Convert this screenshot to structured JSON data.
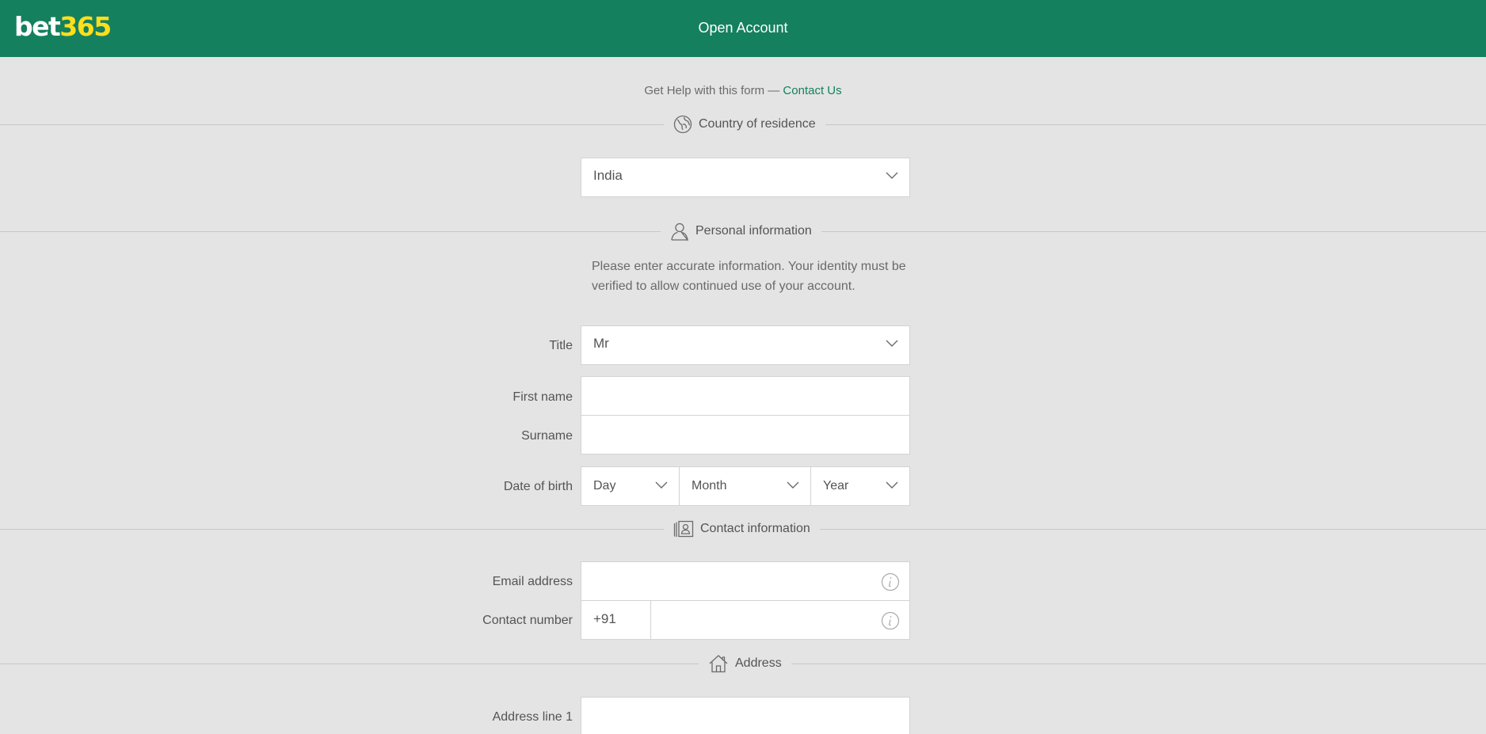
{
  "header": {
    "logo_part1": "bet",
    "logo_part2": "365",
    "title": "Open Account"
  },
  "help": {
    "text": "Get Help with this form — ",
    "link": "Contact Us"
  },
  "sections": {
    "country": {
      "label": "Country of residence",
      "value": "India"
    },
    "personal": {
      "label": "Personal information",
      "note": "Please enter accurate information. Your identity must be verified to allow continued use of your account.",
      "title_label": "Title",
      "title_value": "Mr",
      "first_name_label": "First name",
      "first_name_value": "",
      "surname_label": "Surname",
      "surname_value": "",
      "dob_label": "Date of birth",
      "dob_day": "Day",
      "dob_month": "Month",
      "dob_year": "Year"
    },
    "contact": {
      "label": "Contact information",
      "email_label": "Email address",
      "email_value": "",
      "phone_label": "Contact number",
      "phone_prefix": "+91",
      "phone_value": ""
    },
    "address": {
      "label": "Address",
      "line1_label": "Address line 1",
      "line1_value": ""
    }
  },
  "icons": [
    "globe-icon",
    "person-icon",
    "contact-card-icon",
    "house-icon",
    "chevron-down-icon",
    "info-icon"
  ],
  "colors": {
    "brand_green": "#14805e",
    "logo_yellow": "#ffdf1b",
    "background": "#e4e4e4"
  }
}
